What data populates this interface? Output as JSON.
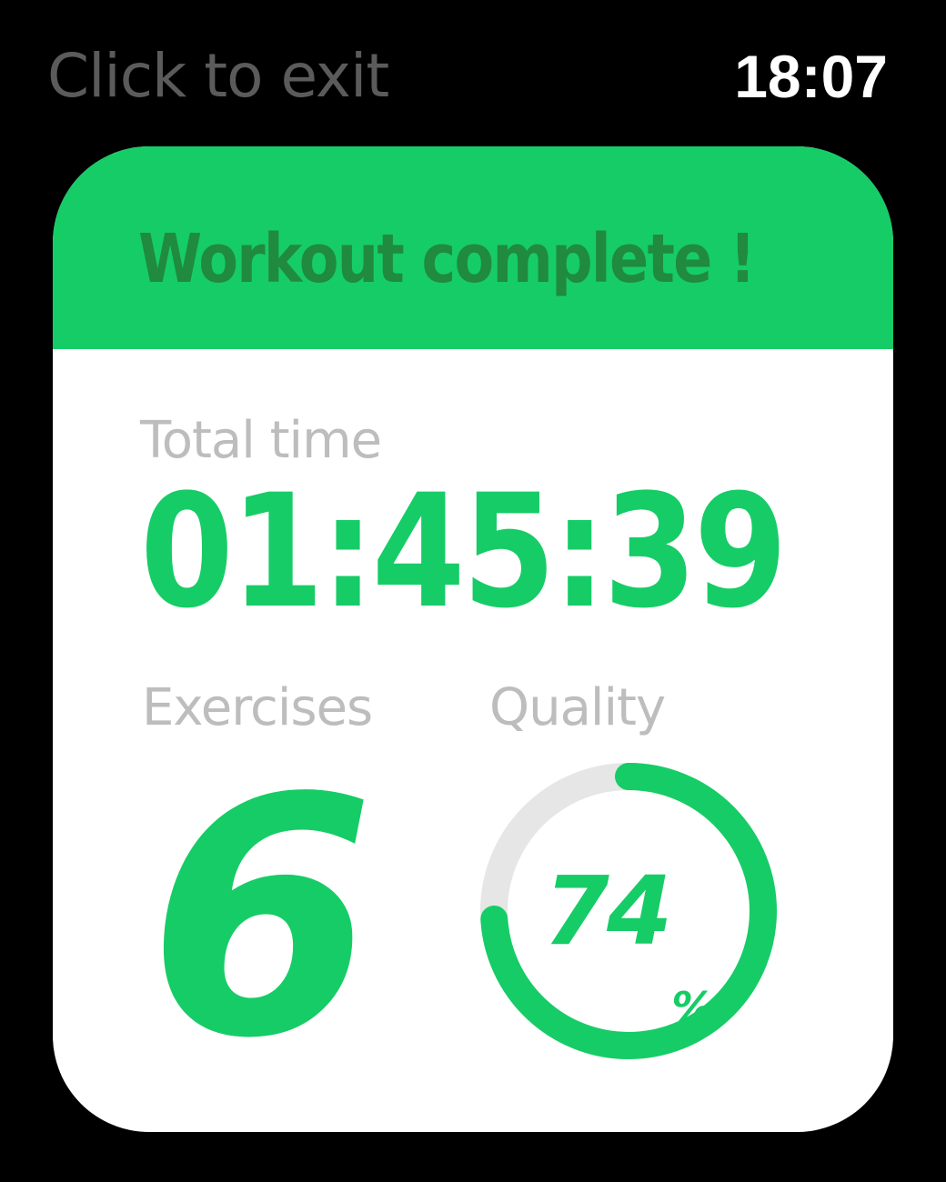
{
  "status_bar": {
    "exit_label": "Click to exit",
    "time": "18:07"
  },
  "card": {
    "title": "Workout complete !",
    "total_time": {
      "label": "Total time",
      "value": "01:45:39"
    },
    "exercises": {
      "label": "Exercises",
      "value": "6"
    },
    "quality": {
      "label": "Quality",
      "value": "74",
      "unit": "%",
      "percent": 74
    }
  },
  "colors": {
    "accent": "#16cc66",
    "title_text": "#208a3e",
    "muted_label": "#bdbdbd",
    "ring_track": "#e6e6e6",
    "background": "#000000",
    "card": "#ffffff"
  }
}
